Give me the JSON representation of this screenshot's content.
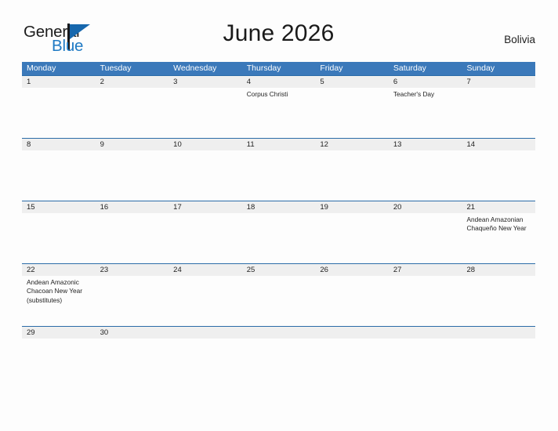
{
  "header": {
    "logo": {
      "word_one": "General",
      "word_two": "Blue",
      "flag_icon": "blue-flag-icon"
    },
    "title": "June 2026",
    "country": "Bolivia"
  },
  "calendar": {
    "weekdays": [
      "Monday",
      "Tuesday",
      "Wednesday",
      "Thursday",
      "Friday",
      "Saturday",
      "Sunday"
    ],
    "colors": {
      "header_blue": "#3b79ba",
      "rule_blue": "#2b6ca8",
      "day_band_gray": "#efefef",
      "page_background": "#fdfdfd",
      "logo_blue": "#1f7ac4",
      "text": "#1f1f1f"
    },
    "weeks": [
      {
        "days": [
          {
            "num": "1",
            "event": ""
          },
          {
            "num": "2",
            "event": ""
          },
          {
            "num": "3",
            "event": ""
          },
          {
            "num": "4",
            "event": "Corpus Christi"
          },
          {
            "num": "5",
            "event": ""
          },
          {
            "num": "6",
            "event": "Teacher's Day"
          },
          {
            "num": "7",
            "event": ""
          }
        ]
      },
      {
        "days": [
          {
            "num": "8",
            "event": ""
          },
          {
            "num": "9",
            "event": ""
          },
          {
            "num": "10",
            "event": ""
          },
          {
            "num": "11",
            "event": ""
          },
          {
            "num": "12",
            "event": ""
          },
          {
            "num": "13",
            "event": ""
          },
          {
            "num": "14",
            "event": ""
          }
        ]
      },
      {
        "days": [
          {
            "num": "15",
            "event": ""
          },
          {
            "num": "16",
            "event": ""
          },
          {
            "num": "17",
            "event": ""
          },
          {
            "num": "18",
            "event": ""
          },
          {
            "num": "19",
            "event": ""
          },
          {
            "num": "20",
            "event": ""
          },
          {
            "num": "21",
            "event": "Andean Amazonian Chaqueño New Year"
          }
        ]
      },
      {
        "days": [
          {
            "num": "22",
            "event": "Andean Amazonic Chacoan New Year (substitutes)"
          },
          {
            "num": "23",
            "event": ""
          },
          {
            "num": "24",
            "event": ""
          },
          {
            "num": "25",
            "event": ""
          },
          {
            "num": "26",
            "event": ""
          },
          {
            "num": "27",
            "event": ""
          },
          {
            "num": "28",
            "event": ""
          }
        ]
      },
      {
        "days": [
          {
            "num": "29",
            "event": ""
          },
          {
            "num": "30",
            "event": ""
          },
          {
            "num": "",
            "event": ""
          },
          {
            "num": "",
            "event": ""
          },
          {
            "num": "",
            "event": ""
          },
          {
            "num": "",
            "event": ""
          },
          {
            "num": "",
            "event": ""
          }
        ]
      }
    ]
  }
}
